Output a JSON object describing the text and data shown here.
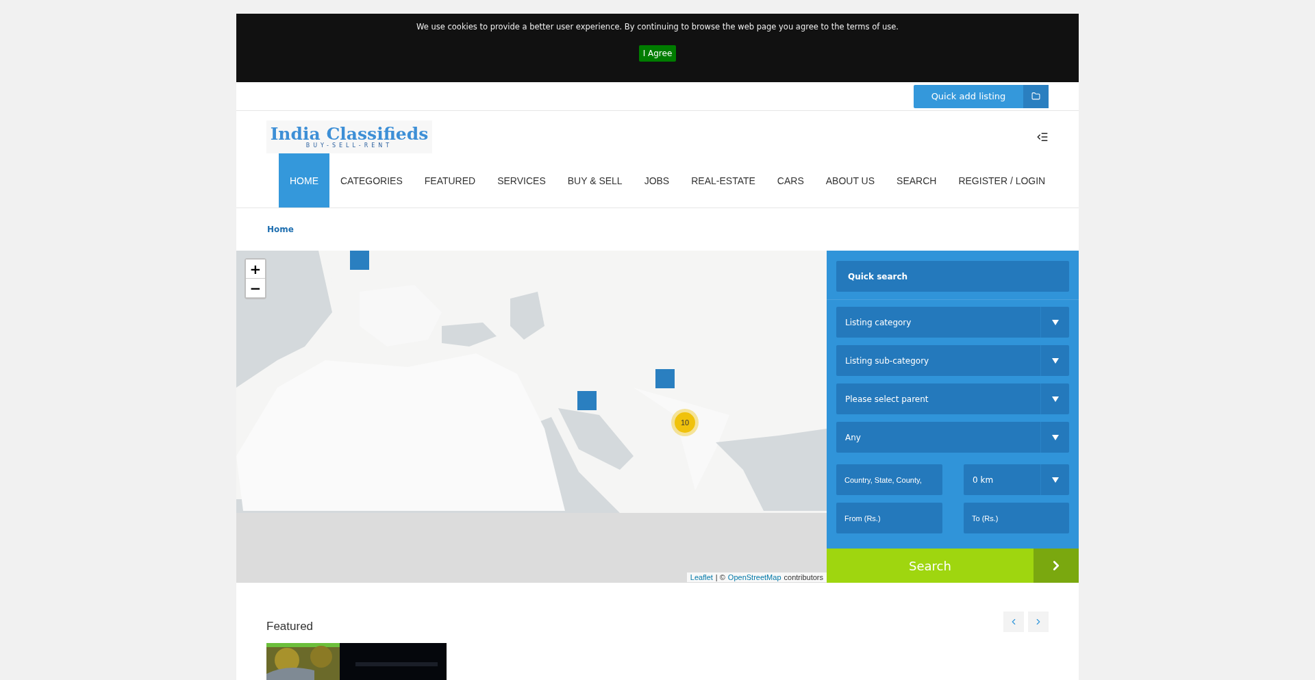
{
  "cookie_bar": {
    "message": "We use cookies to provide a better user experience. By continuing to browse the web page you agree to the terms of use.",
    "button": "I Agree"
  },
  "top_bar": {
    "quick_add": "Quick add listing"
  },
  "logo": {
    "title": "India Classifieds",
    "tagline": "BUY-SELL-RENT"
  },
  "nav": [
    {
      "label": "HOME",
      "selected": true
    },
    {
      "label": "CATEGORIES",
      "selected": false
    },
    {
      "label": "FEATURED",
      "selected": false
    },
    {
      "label": "SERVICES",
      "selected": false
    },
    {
      "label": "BUY & SELL",
      "selected": false
    },
    {
      "label": "JOBS",
      "selected": false
    },
    {
      "label": "REAL-ESTATE",
      "selected": false
    },
    {
      "label": "CARS",
      "selected": false
    },
    {
      "label": "ABOUT US",
      "selected": false
    },
    {
      "label": "SEARCH",
      "selected": false
    },
    {
      "label": "REGISTER / LOGIN",
      "selected": false
    }
  ],
  "breadcrumb": "Home",
  "map": {
    "zoom_in": "+",
    "zoom_out": "−",
    "markers": [
      {
        "kind": "marker"
      },
      {
        "kind": "marker"
      },
      {
        "kind": "marker"
      },
      {
        "kind": "cluster",
        "count": "10"
      }
    ],
    "attribution": {
      "leaflet": "Leaflet",
      "separator": "| ©",
      "osm": "OpenStreetMap",
      "suffix": "contributors"
    }
  },
  "quick_search": {
    "title": "Quick search",
    "selects": [
      "Listing category",
      "Listing sub-category",
      "Please select parent",
      "Any"
    ],
    "location": {
      "placeholder": "Country, State, County,"
    },
    "radius": "0 km",
    "price_from": {
      "placeholder": "From (Rs.)"
    },
    "price_to": {
      "placeholder": "To (Rs.)"
    },
    "search_button": "Search"
  },
  "featured": {
    "title": "Featured"
  }
}
